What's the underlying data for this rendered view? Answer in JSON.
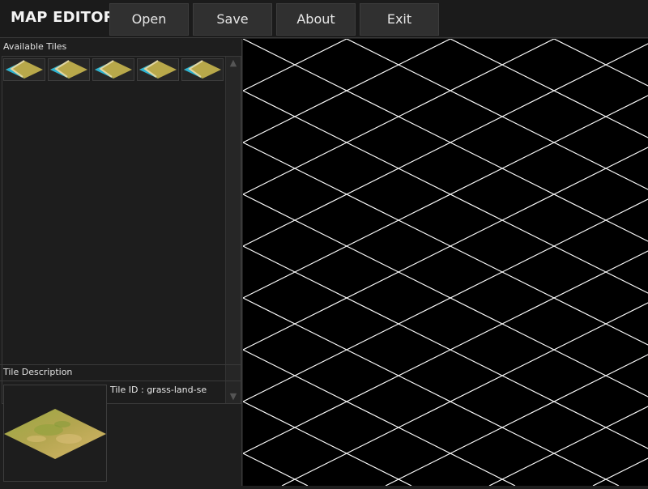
{
  "app": {
    "title": "MAP EDITOR"
  },
  "menu": [
    {
      "label": "Open"
    },
    {
      "label": "Save"
    },
    {
      "label": "About"
    },
    {
      "label": "Exit"
    }
  ],
  "tiles_panel": {
    "label": "Available Tiles",
    "tiles": [
      {
        "icon": "coast-tile-icon"
      },
      {
        "icon": "coast-tile-icon"
      },
      {
        "icon": "coast-tile-icon"
      },
      {
        "icon": "coast-tile-icon"
      },
      {
        "icon": "coast-tile-icon"
      }
    ],
    "scroll_up_glyph": "▲",
    "scroll_down_glyph": "▼"
  },
  "description_panel": {
    "label": "Tile Description",
    "tile_id_label": "Tile ID :",
    "tile_id": "grass-land-se"
  },
  "colors": {
    "grid_line": "#ffffff",
    "canvas_bg": "#000000",
    "water": "#2ab3d4",
    "grass": "#b8a84a",
    "sand": "#d8c58a"
  },
  "map": {
    "grid": "isometric"
  }
}
